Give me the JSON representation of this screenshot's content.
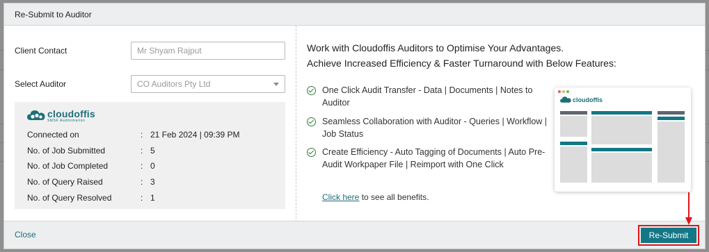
{
  "modal": {
    "title": "Re-Submit to Auditor"
  },
  "form": {
    "client_contact_label": "Client Contact",
    "client_contact_placeholder": "Mr Shyam Rajput",
    "select_auditor_label": "Select Auditor",
    "select_auditor_value": "CO Auditors Pty Ltd"
  },
  "stats": {
    "logo_name": "cloudoffis",
    "logo_sub": "SMSF Auditomation",
    "rows": [
      {
        "label": "Connected on",
        "value": "21 Feb 2024 | 09:39 PM"
      },
      {
        "label": "No. of Job Submitted",
        "value": "5"
      },
      {
        "label": "No. of Job Completed",
        "value": "0"
      },
      {
        "label": "No. of Query Raised",
        "value": "3"
      },
      {
        "label": "No. of Query Resolved",
        "value": "1"
      }
    ]
  },
  "promo": {
    "heading_1": "Work with Cloudoffis Auditors to Optimise Your Advantages.",
    "heading_2": "Achieve Increased Efficiency & Faster Turnaround with Below Features:",
    "features": [
      "One Click Audit Transfer - Data | Documents | Notes to Auditor",
      "Seamless Collaboration with Auditor - Queries | Workflow | Job Status",
      "Create Efficiency - Auto Tagging of Documents | Auto Pre-Audit Workpaper File | Reimport with One Click"
    ],
    "more_link": "Click here",
    "more_text": " to see all benefits.",
    "preview_logo": "cloudoffis",
    "preview_sub": "SMSF Auditomation"
  },
  "footer": {
    "close_label": "Close",
    "resubmit_label": "Re-Submit"
  },
  "colors": {
    "accent": "#137786",
    "highlight": "#e0141a",
    "check": "#2f7d3a"
  }
}
